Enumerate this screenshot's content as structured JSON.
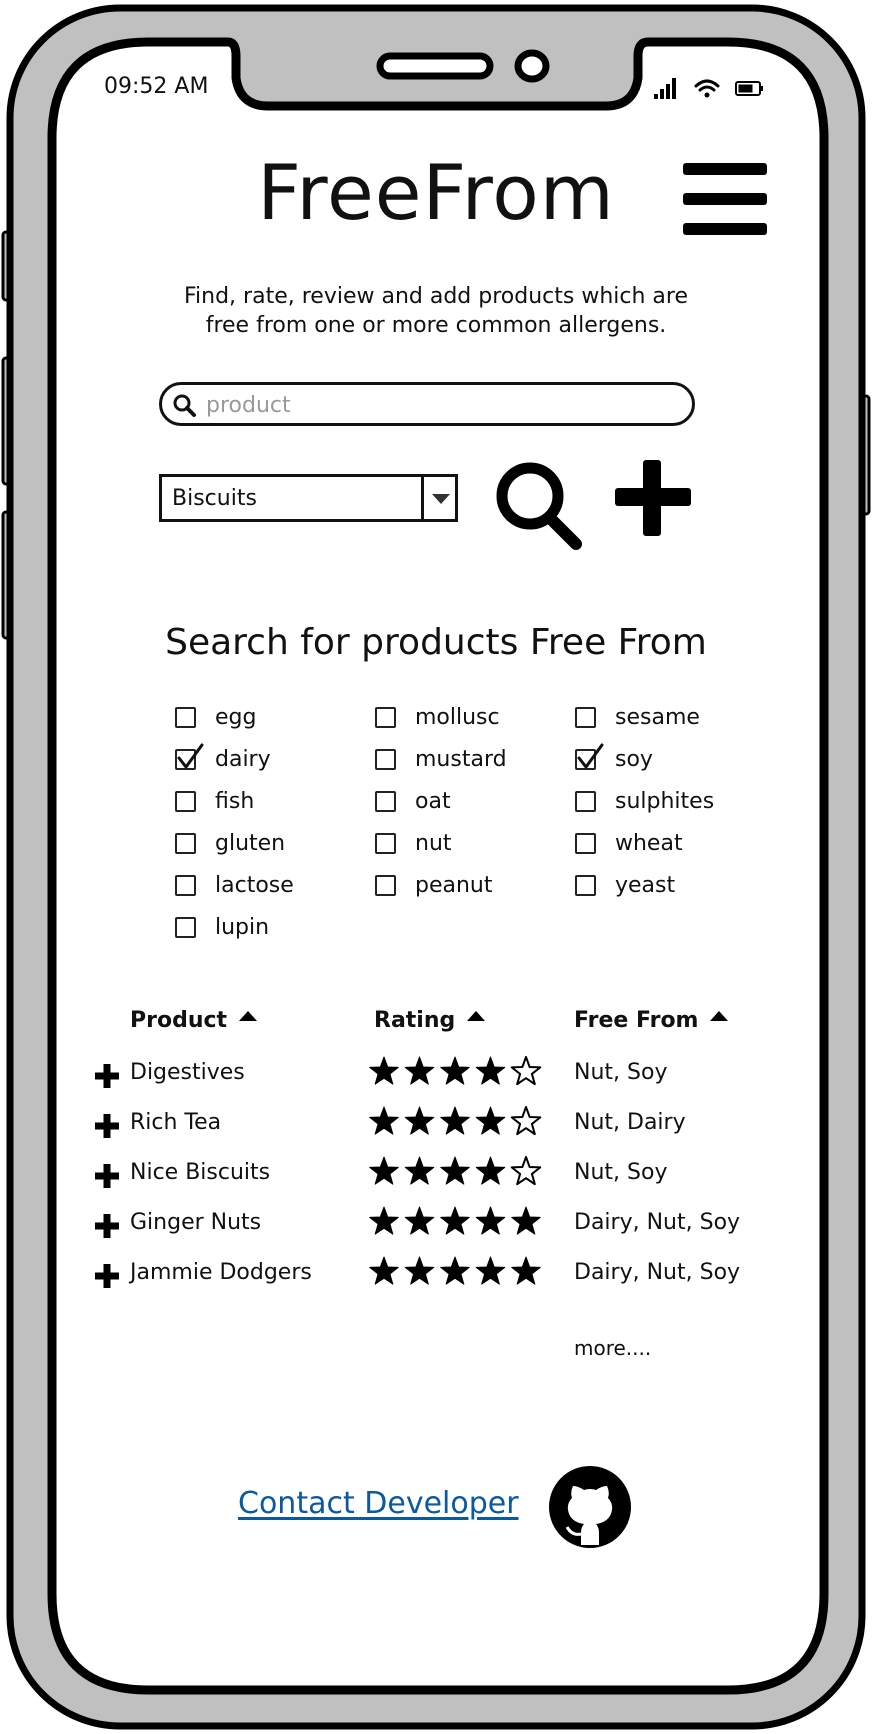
{
  "status_bar": {
    "time": "09:52 AM",
    "icons": [
      "signal-icon",
      "wifi-icon",
      "battery-icon"
    ]
  },
  "header": {
    "title": "FreeFrom",
    "menu_icon": "hamburger-menu-icon"
  },
  "tagline": {
    "line1": "Find, rate, review and add products which are",
    "line2": "free from one or more common allergens."
  },
  "search": {
    "placeholder": "product",
    "value": ""
  },
  "category": {
    "selected": "Biscuits"
  },
  "actions": {
    "search_icon": "search-icon",
    "add_icon": "plus-icon"
  },
  "filter": {
    "heading": "Search for products Free From",
    "columns": [
      [
        {
          "label": "egg",
          "checked": false
        },
        {
          "label": "dairy",
          "checked": true
        },
        {
          "label": "fish",
          "checked": false
        },
        {
          "label": "gluten",
          "checked": false
        },
        {
          "label": "lactose",
          "checked": false
        },
        {
          "label": "lupin",
          "checked": false
        }
      ],
      [
        {
          "label": "mollusc",
          "checked": false
        },
        {
          "label": "mustard",
          "checked": false
        },
        {
          "label": "oat",
          "checked": false
        },
        {
          "label": "nut",
          "checked": false
        },
        {
          "label": "peanut",
          "checked": false
        }
      ],
      [
        {
          "label": "sesame",
          "checked": false
        },
        {
          "label": "soy",
          "checked": true
        },
        {
          "label": "sulphites",
          "checked": false
        },
        {
          "label": "wheat",
          "checked": false
        },
        {
          "label": "yeast",
          "checked": false
        }
      ]
    ]
  },
  "table": {
    "headers": {
      "product": "Product",
      "rating": "Rating",
      "free_from": "Free From"
    },
    "max_rating": 5,
    "rows": [
      {
        "product": "Digestives",
        "rating": 4,
        "free_from": "Nut, Soy"
      },
      {
        "product": "Rich Tea",
        "rating": 4,
        "free_from": "Nut, Dairy"
      },
      {
        "product": "Nice Biscuits",
        "rating": 4,
        "free_from": "Nut, Soy"
      },
      {
        "product": "Ginger Nuts",
        "rating": 5,
        "free_from": "Dairy, Nut, Soy"
      },
      {
        "product": "Jammie Dodgers",
        "rating": 5,
        "free_from": "Dairy, Nut, Soy"
      }
    ],
    "more_label": "more...."
  },
  "footer": {
    "contact_label": "Contact Developer",
    "github_icon": "github-icon",
    "link_color": "#0b5aa0"
  }
}
